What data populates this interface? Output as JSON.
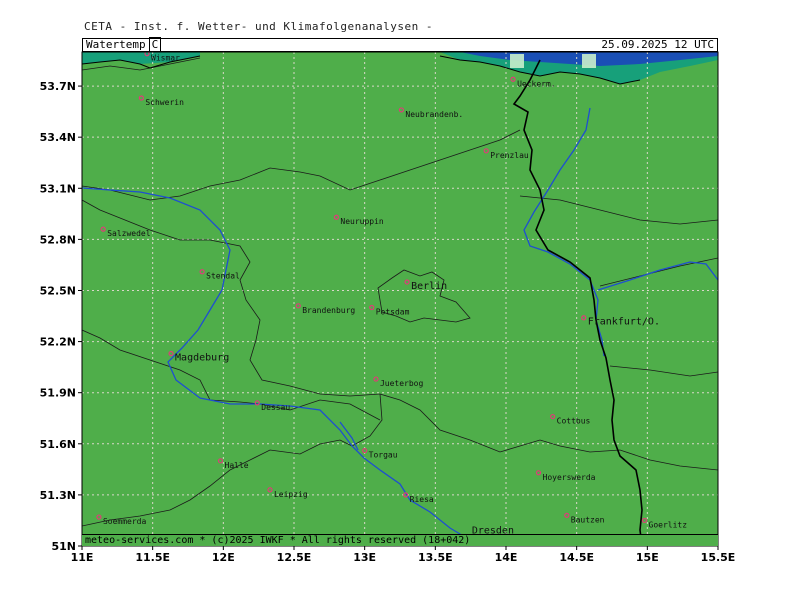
{
  "title": "CETA - Inst. f. Wetter- und Klimafolgenanalysen -",
  "header": {
    "parameter": "Watertemp",
    "unit": "C",
    "valid_time": "25.09.2025 12 UTC"
  },
  "footer": "meteo-services.com * (c)2025 IWKF * All rights reserved (18+042)",
  "colors": {
    "land": "#4fae4a",
    "sea_dark": "#1a4fb5",
    "sea_light": "#17a07a",
    "river": "#1e4fd0",
    "border": "#000000",
    "grid": "#d8d8c8",
    "city_dot": "#e03c78"
  },
  "axes": {
    "lon_min": 11.0,
    "lon_max": 15.5,
    "lat_min": 51.0,
    "lat_max": 53.9,
    "x_ticks": [
      {
        "v": 11.0,
        "label": "11E"
      },
      {
        "v": 11.5,
        "label": "11.5E"
      },
      {
        "v": 12.0,
        "label": "12E"
      },
      {
        "v": 12.5,
        "label": "12.5E"
      },
      {
        "v": 13.0,
        "label": "13E"
      },
      {
        "v": 13.5,
        "label": "13.5E"
      },
      {
        "v": 14.0,
        "label": "14E"
      },
      {
        "v": 14.5,
        "label": "14.5E"
      },
      {
        "v": 15.0,
        "label": "15E"
      },
      {
        "v": 15.5,
        "label": "15.5E"
      }
    ],
    "y_ticks": [
      {
        "v": 51.0,
        "label": "51N"
      },
      {
        "v": 51.3,
        "label": "51.3N"
      },
      {
        "v": 51.6,
        "label": "51.6N"
      },
      {
        "v": 51.9,
        "label": "51.9N"
      },
      {
        "v": 52.2,
        "label": "52.2N"
      },
      {
        "v": 52.5,
        "label": "52.5N"
      },
      {
        "v": 52.8,
        "label": "52.8N"
      },
      {
        "v": 53.1,
        "label": "53.1N"
      },
      {
        "v": 53.4,
        "label": "53.4N"
      },
      {
        "v": 53.7,
        "label": "53.7N"
      }
    ]
  },
  "cities": [
    {
      "name": "Wismar",
      "lon": 11.46,
      "lat": 53.89
    },
    {
      "name": "Schwerin",
      "lon": 11.42,
      "lat": 53.63
    },
    {
      "name": "Neubrandenb.",
      "lon": 13.26,
      "lat": 53.56
    },
    {
      "name": "Ueckerm.",
      "lon": 14.05,
      "lat": 53.74
    },
    {
      "name": "Prenzlau",
      "lon": 13.86,
      "lat": 53.32
    },
    {
      "name": "Neuruppin",
      "lon": 12.8,
      "lat": 52.93
    },
    {
      "name": "Salzwedel",
      "lon": 11.15,
      "lat": 52.86
    },
    {
      "name": "Stendal",
      "lon": 11.85,
      "lat": 52.61
    },
    {
      "name": "Berlin",
      "lon": 13.3,
      "lat": 52.55
    },
    {
      "name": "Brandenburg",
      "lon": 12.53,
      "lat": 52.41
    },
    {
      "name": "Potsdam",
      "lon": 13.05,
      "lat": 52.4
    },
    {
      "name": "Frankfurt/O.",
      "lon": 14.55,
      "lat": 52.34
    },
    {
      "name": "Magdeburg",
      "lon": 11.63,
      "lat": 52.13
    },
    {
      "name": "Jueterbog",
      "lon": 13.08,
      "lat": 51.98
    },
    {
      "name": "Dessau",
      "lon": 12.24,
      "lat": 51.84
    },
    {
      "name": "Cottbus",
      "lon": 14.33,
      "lat": 51.76
    },
    {
      "name": "Torgau",
      "lon": 13.0,
      "lat": 51.56
    },
    {
      "name": "Halle",
      "lon": 11.98,
      "lat": 51.5
    },
    {
      "name": "Hoyerswerda",
      "lon": 14.23,
      "lat": 51.43
    },
    {
      "name": "Leipzig",
      "lon": 12.33,
      "lat": 51.33
    },
    {
      "name": "Riesa",
      "lon": 13.29,
      "lat": 51.3
    },
    {
      "name": "Bautzen",
      "lon": 14.43,
      "lat": 51.18
    },
    {
      "name": "Goerlitz",
      "lon": 14.98,
      "lat": 51.15
    },
    {
      "name": "Soemmerda",
      "lon": 11.12,
      "lat": 51.17
    },
    {
      "name": "Dresden",
      "lon": 13.73,
      "lat": 51.05
    }
  ]
}
